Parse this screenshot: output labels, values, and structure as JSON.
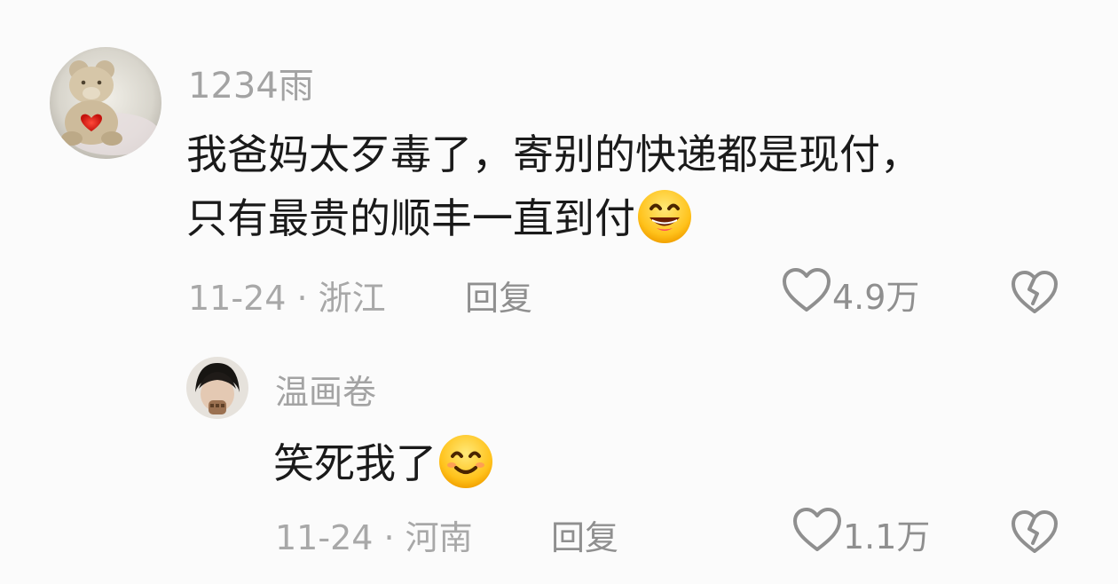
{
  "comments": [
    {
      "username": "1234雨",
      "text_line1": "我爸妈太歹毒了，寄别的快递都是现付，",
      "text_line2": "只有最贵的顺丰一直到付",
      "emoji": "grinning-face-icon",
      "meta": "11-24 · 浙江",
      "reply_label": "回复",
      "likes": "4.9万"
    },
    {
      "username": "温画卷",
      "text": "笑死我了",
      "emoji": "smiling-face-icon",
      "meta": "11-24 · 河南",
      "reply_label": "回复",
      "likes": "1.1万"
    }
  ],
  "colors": {
    "background": "#fbfbfb",
    "username": "#a3a3a3",
    "content": "#1a1a1a",
    "meta": "#a8a8a8",
    "action": "#8f8f8f"
  }
}
